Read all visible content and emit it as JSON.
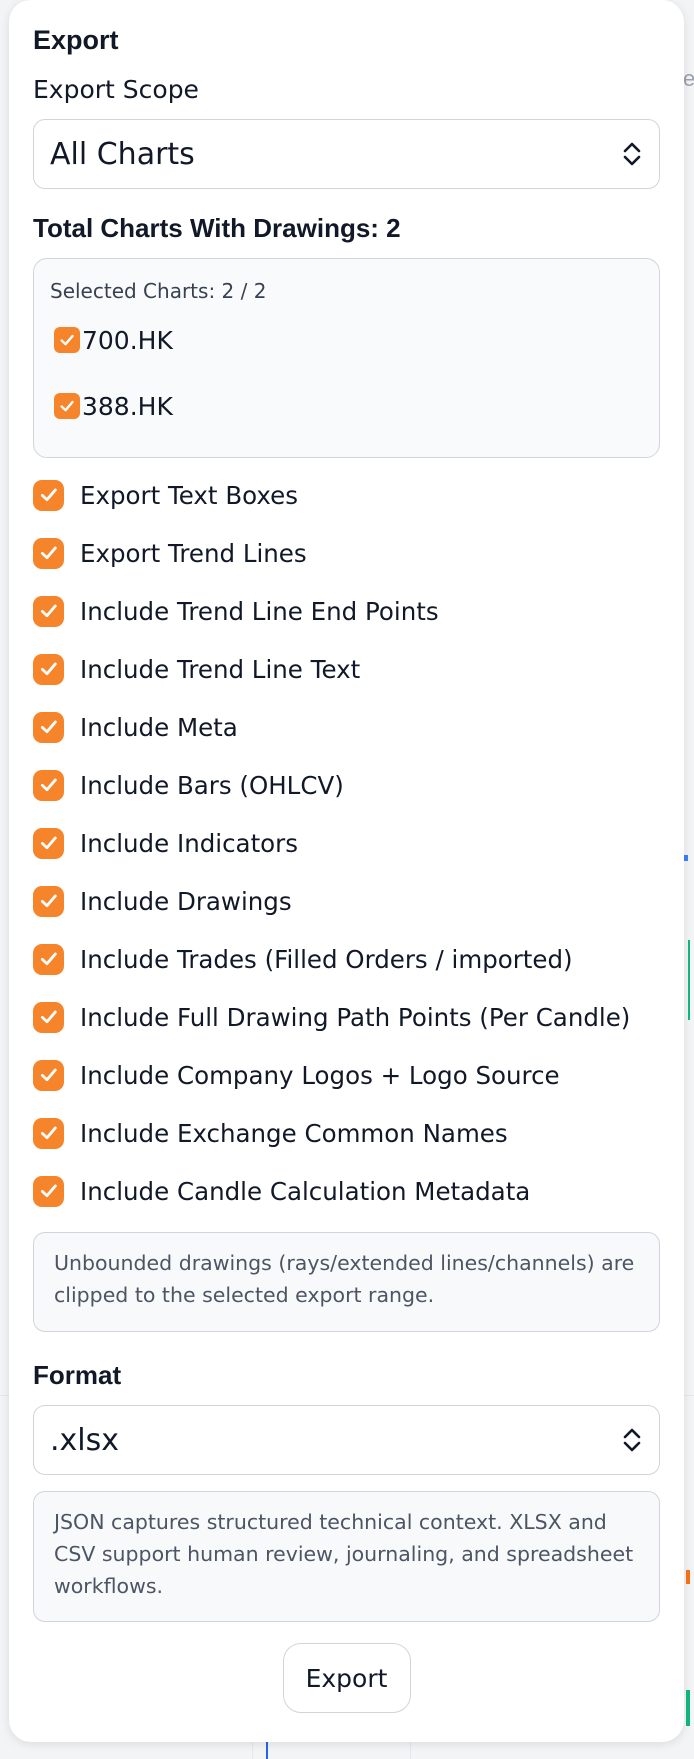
{
  "panel": {
    "title": "Export",
    "scope_label": "Export Scope",
    "scope_value": "All Charts",
    "total_label": "Total Charts With Drawings: 2",
    "selected_label": "Selected Charts: 2 / 2",
    "charts": [
      {
        "symbol": "700.HK",
        "checked": true
      },
      {
        "symbol": "388.HK",
        "checked": true
      }
    ],
    "options": [
      {
        "label": "Export Text Boxes",
        "checked": true
      },
      {
        "label": "Export Trend Lines",
        "checked": true
      },
      {
        "label": "Include Trend Line End Points",
        "checked": true
      },
      {
        "label": "Include Trend Line Text",
        "checked": true
      },
      {
        "label": "Include Meta",
        "checked": true
      },
      {
        "label": "Include Bars (OHLCV)",
        "checked": true
      },
      {
        "label": "Include Indicators",
        "checked": true
      },
      {
        "label": "Include Drawings",
        "checked": true
      },
      {
        "label": "Include Trades (Filled Orders / imported)",
        "checked": true
      },
      {
        "label": "Include Full Drawing Path Points (Per Candle)",
        "checked": true
      },
      {
        "label": "Include Company Logos + Logo Source",
        "checked": true
      },
      {
        "label": "Include Exchange Common Names",
        "checked": true
      },
      {
        "label": "Include Candle Calculation Metadata",
        "checked": true
      }
    ],
    "clip_note": "Unbounded drawings (rays/extended lines/channels) are clipped to the selected export range.",
    "format_label": "Format",
    "format_value": ".xlsx",
    "format_note": "JSON captures structured technical context. XLSX and CSV support human review, journaling, and spreadsheet workflows.",
    "export_button": "Export"
  },
  "background": {
    "fragment_right": "e"
  },
  "colors": {
    "accent": "#f5842a",
    "panel_bg": "#ffffff",
    "note_bg": "#f8f9fb",
    "border": "#d1d5db"
  },
  "icons": {
    "checkbox": "checkmark-icon",
    "select": "chevron-up-down-icon"
  }
}
